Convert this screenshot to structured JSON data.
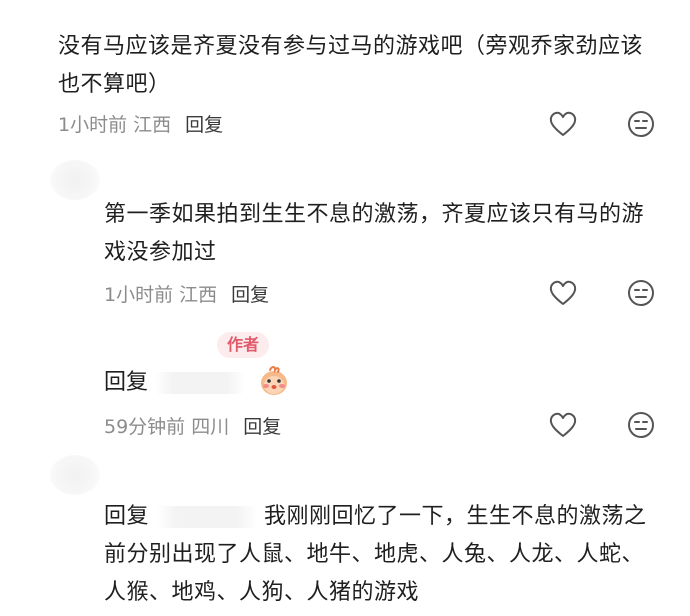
{
  "comments": [
    {
      "text_line1": "没有马应该是齐夏没有参与过马的游戏吧（旁观乔家劲应该",
      "text_line2": "也不算吧）",
      "time": "1小时前",
      "location": "江西",
      "reply_label": "回复"
    },
    {
      "text_line1": "第一季如果拍到生生不息的激荡，齐夏应该只有马的游",
      "text_line2": "戏没参加过",
      "time": "1小时前",
      "location": "江西",
      "reply_label": "回复"
    },
    {
      "badge": "作者",
      "reply_prefix": "回复",
      "time": "59分钟前",
      "location": "四川",
      "reply_label": "回复"
    },
    {
      "reply_prefix": "回复",
      "text_line1": "我刚刚回忆了一下，生生不息的激荡之",
      "text_line2": "前分别出现了人鼠、地牛、地虎、人兔、人龙、人蛇、",
      "text_line3": "人猴、地鸡、人狗、人猪的游戏"
    }
  ],
  "icons": {
    "like": "heart-outline-icon",
    "dislike": "meh-face-icon",
    "sticker": "blushing-bird-emoji"
  },
  "colors": {
    "badge_bg": "#fdeced",
    "badge_text": "#e05a6a",
    "meta_text": "#8c8c8c"
  }
}
